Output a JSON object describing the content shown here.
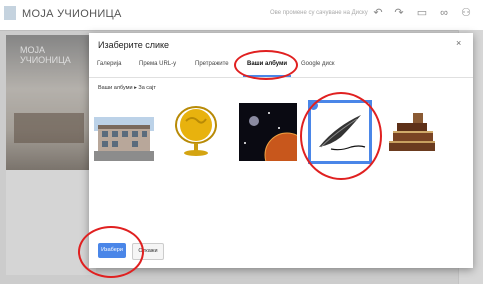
{
  "app": {
    "site_title": "МОЈА УЧИОНИЦА",
    "header_title": "МОЈА УЧИОНИЦА",
    "hint": "Ове промене су сачуване на Диску"
  },
  "dialog": {
    "title": "Изаберите слике",
    "close_label": "×",
    "tabs": [
      {
        "label": "Галерија"
      },
      {
        "label": "Према URL-у"
      },
      {
        "label": "Претражите"
      },
      {
        "label": "Ваши албуми"
      },
      {
        "label": "Google диск"
      }
    ],
    "active_tab": "Ваши албуми",
    "breadcrumb": "Ваши албуми  ▸  За сајт",
    "images": [
      {
        "name": "school-building-image"
      },
      {
        "name": "golden-globe-image"
      },
      {
        "name": "planets-image"
      },
      {
        "name": "quill-pen-image",
        "selected": true
      },
      {
        "name": "old-books-image"
      }
    ],
    "select_button": "Изабери",
    "cancel_button": "Откажи"
  },
  "icons": {
    "undo": "undo-icon",
    "redo": "redo-icon",
    "preview": "preview-icon",
    "link": "link-icon",
    "share": "share-icon",
    "check": "check-icon",
    "close": "close-icon"
  },
  "colors": {
    "accent": "#4a86e8",
    "annotation": "#e02020"
  }
}
